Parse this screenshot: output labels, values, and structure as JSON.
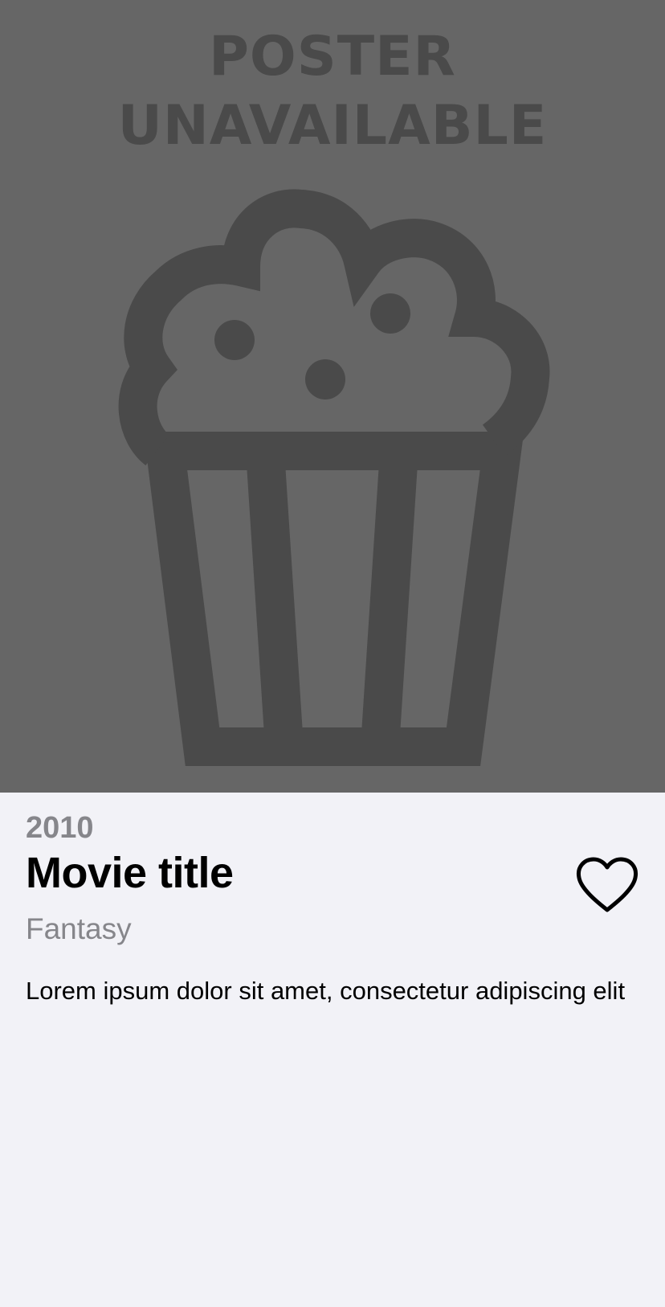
{
  "poster": {
    "placeholder_line1": "POSTER",
    "placeholder_line2": "UNAVAILABLE",
    "icon": "popcorn-icon",
    "background_color": "#666666",
    "foreground_color": "#4a4a4a"
  },
  "movie": {
    "year": "2010",
    "title": "Movie title",
    "genre": "Fantasy",
    "description": "Lorem ipsum dolor sit amet, consectetur adipiscing elit",
    "favorite_icon": "heart-outline-icon"
  },
  "colors": {
    "background": "#f2f2f7",
    "secondary_text": "#86868b",
    "primary_text": "#000000"
  }
}
